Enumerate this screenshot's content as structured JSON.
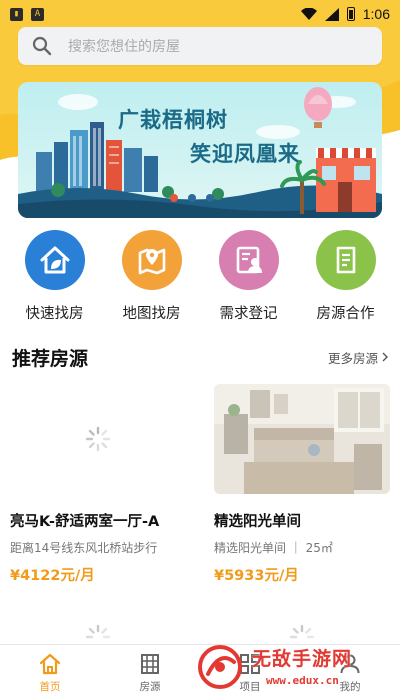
{
  "status_bar": {
    "time": "1:06"
  },
  "search": {
    "placeholder": "搜索您想住的房屋"
  },
  "banner": {
    "line1": "广栽梧桐树",
    "line2": "笑迎凤凰来"
  },
  "quick_actions": [
    {
      "label": "快速找房",
      "icon": "house-leaf-icon",
      "color": "#2a7fd7"
    },
    {
      "label": "地图找房",
      "icon": "map-pin-icon",
      "color": "#f3a23a"
    },
    {
      "label": "需求登记",
      "icon": "person-card-icon",
      "color": "#d77fb0"
    },
    {
      "label": "房源合作",
      "icon": "document-icon",
      "color": "#8bc34a"
    }
  ],
  "recommend": {
    "title": "推荐房源",
    "more_label": "更多房源"
  },
  "listings": [
    {
      "title": "亮马K-舒适两室一厅-A",
      "subtitle": "距离14号线东风北桥站步行",
      "price": "¥4122元/月"
    },
    {
      "title": "精选阳光单间",
      "subtitle": "精选阳光单间 ｜ 25㎡",
      "price": "¥5933元/月"
    }
  ],
  "tabbar": [
    {
      "label": "首页",
      "active": true
    },
    {
      "label": "房源",
      "active": false
    },
    {
      "label": "项目",
      "active": false
    },
    {
      "label": "我的",
      "active": false
    }
  ],
  "watermark": {
    "text": "无敌手游网",
    "url": "www.edux.cn"
  },
  "colors": {
    "accent": "#f29a1a",
    "header": "#f8c12a"
  }
}
